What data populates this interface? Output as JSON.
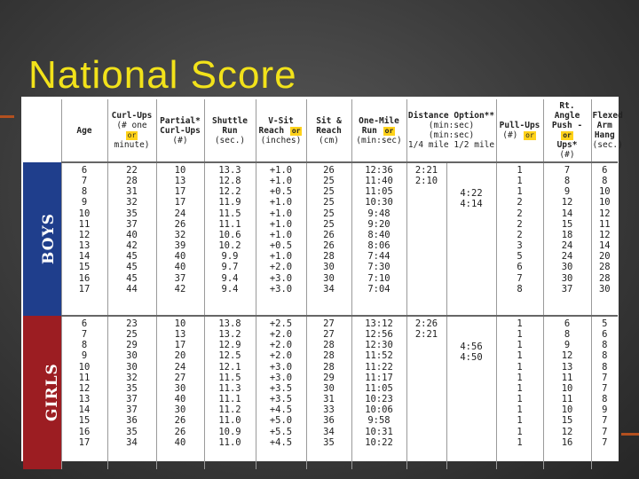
{
  "slide": {
    "title": "National Score",
    "colors": {
      "title": "#f2e21a",
      "boys": "#1f3e8c",
      "girls": "#9c1d22",
      "or_badge": "#ffd21a"
    }
  },
  "header": {
    "age": "Age",
    "curl_ups": [
      "Curl-Ups",
      "(# one",
      "minute)"
    ],
    "partial": [
      "Partial*",
      "Curl-Ups",
      "(#)"
    ],
    "or": "or",
    "shuttle": [
      "Shuttle",
      "Run",
      "(sec.)"
    ],
    "vsit": [
      "V-Sit",
      "Reach",
      "(inches)"
    ],
    "sitreach": [
      "Sit &",
      "Reach",
      "(cm)"
    ],
    "onemile": [
      "One-Mile",
      "Run",
      "(min:sec)"
    ],
    "distance": [
      "Distance Option**",
      "(min:sec) (min:sec)",
      "1/4 mile  1/2 mile"
    ],
    "pullups": [
      "Pull-Ups",
      "(#)"
    ],
    "rtangle": [
      "Rt. Angle",
      "Push -",
      "Ups*",
      "(#)"
    ],
    "flexed": [
      "Flexed",
      "Arm",
      "Hang",
      "(sec.)"
    ]
  },
  "boys": {
    "label": "BOYS",
    "age": "6\n7\n8\n9\n10\n11\n12\n13\n14\n15\n16\n17",
    "curl": "22\n28\n31\n32\n35\n37\n40\n42\n45\n45\n45\n44",
    "partial": "10\n13\n17\n17\n24\n26\n32\n39\n40\n40\n37\n42",
    "shuttle": "13.3\n12.8\n12.2\n11.9\n11.5\n11.1\n10.6\n10.2\n9.9\n9.7\n9.4\n9.4",
    "vsit": "+1.0\n+1.0\n+0.5\n+1.0\n+1.0\n+1.0\n+1.0\n+0.5\n+1.0\n+2.0\n+3.0\n+3.0",
    "sitreach": "26\n25\n25\n25\n25\n25\n26\n26\n28\n30\n30\n34",
    "mile": "12:36\n11:40\n11:05\n10:30\n9:48\n9:20\n8:40\n8:06\n7:44\n7:30\n7:10\n7:04",
    "quarter": "2:21\n2:10",
    "half": "4:22\n4:14",
    "pullups": "1\n1\n1\n2\n2\n2\n2\n3\n5\n6\n7\n8",
    "pushups": "7\n8\n9\n12\n14\n15\n18\n24\n24\n30\n30\n37",
    "flexed": "6\n8\n10\n10\n12\n11\n12\n14\n20\n28\n28\n30"
  },
  "girls": {
    "label": "GIRLS",
    "age": "6\n7\n8\n9\n10\n11\n12\n13\n14\n15\n16\n17",
    "curl": "23\n25\n29\n30\n30\n32\n35\n37\n37\n36\n35\n34",
    "partial": "10\n13\n17\n20\n24\n27\n30\n40\n30\n26\n26\n40",
    "shuttle": "13.8\n13.2\n12.9\n12.5\n12.1\n11.5\n11.3\n11.1\n11.2\n11.0\n10.9\n11.0",
    "vsit": "+2.5\n+2.0\n+2.0\n+2.0\n+3.0\n+3.0\n+3.5\n+3.5\n+4.5\n+5.0\n+5.5\n+4.5",
    "sitreach": "27\n27\n28\n28\n28\n29\n30\n31\n33\n36\n34\n35",
    "mile": "13:12\n12:56\n12:30\n11:52\n11:22\n11:17\n11:05\n10:23\n10:06\n9:58\n10:31\n10:22",
    "quarter": "2:26\n2:21",
    "half": "4:56\n4:50",
    "pullups": "1\n1\n1\n1\n1\n1\n1\n1\n1\n1\n1\n1",
    "pushups": "6\n8\n9\n12\n13\n11\n10\n11\n10\n15\n12\n16",
    "flexed": "5\n6\n8\n8\n8\n7\n7\n8\n9\n7\n7\n7"
  }
}
